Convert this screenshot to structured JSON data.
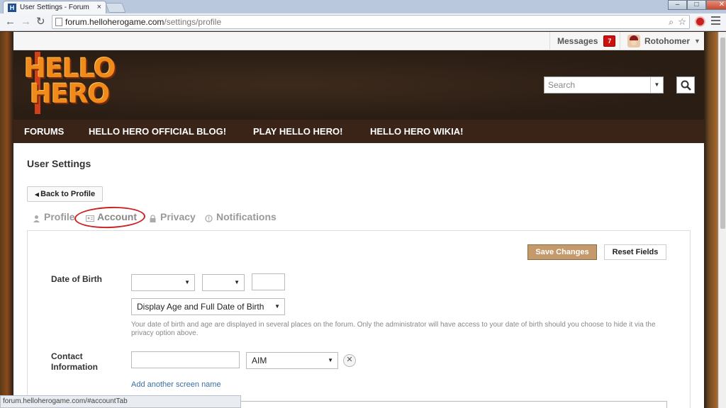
{
  "browser": {
    "tab_title": "User Settings - Forum",
    "tab_close": "×",
    "url_domain": "forum.helloherogame.com",
    "url_path": "/settings/profile",
    "status_url": "forum.helloherogame.com/#accountTab"
  },
  "userbar": {
    "messages_label": "Messages",
    "messages_count": "7",
    "username": "Rotohomer"
  },
  "banner": {
    "logo_line1": "HELLO",
    "logo_line2": "HERO",
    "search_placeholder": "Search"
  },
  "nav": {
    "items": [
      "FORUMS",
      "HELLO HERO OFFICIAL BLOG!",
      "PLAY HELLO HERO!",
      "HELLO HERO WIKIA!"
    ]
  },
  "settings": {
    "title": "User Settings",
    "back_label": "Back to Profile",
    "tabs": [
      "Profile",
      "Account",
      "Privacy",
      "Notifications"
    ],
    "save_label": "Save Changes",
    "reset_label": "Reset Fields",
    "dob_label": "Date of Birth",
    "dob_display_option": "Display Age and Full Date of Birth",
    "dob_help": "Your date of birth and age are displayed in several places on the forum. Only the administrator will have access to your date of birth should you choose to hide it via the privacy option above.",
    "contact_label": "Contact Information",
    "contact_service": "AIM",
    "add_screen_name": "Add another screen name"
  }
}
